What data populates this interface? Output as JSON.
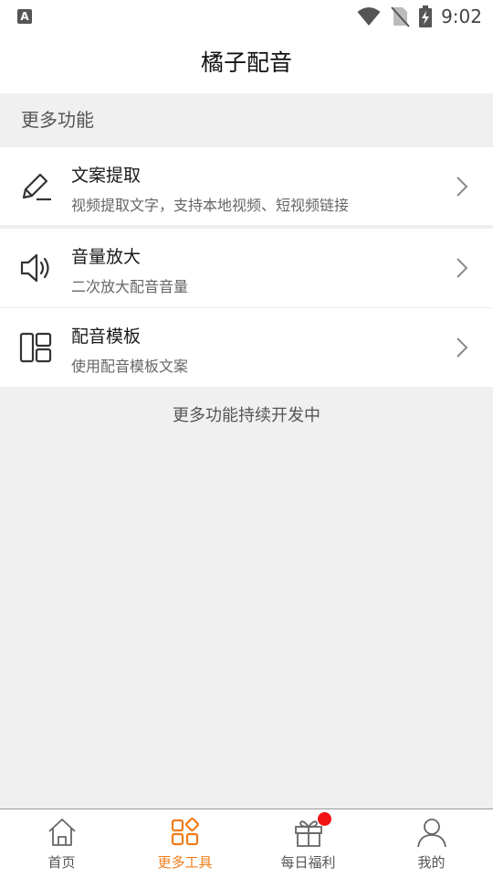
{
  "status_bar": {
    "left_icon_glyph": "A",
    "time": "9:02"
  },
  "header": {
    "title": "橘子配音"
  },
  "section": {
    "label": "更多功能"
  },
  "items": [
    {
      "icon": "pencil-icon",
      "title": "文案提取",
      "subtitle": "视频提取文字，支持本地视频、短视频链接"
    },
    {
      "icon": "speaker-icon",
      "title": "音量放大",
      "subtitle": "二次放大配音音量"
    },
    {
      "icon": "template-icon",
      "title": "配音模板",
      "subtitle": "使用配音模板文案"
    }
  ],
  "footer_note": "更多功能持续开发中",
  "tabs": [
    {
      "label": "首页",
      "icon": "home-icon",
      "active": false
    },
    {
      "label": "更多工具",
      "icon": "tools-grid-icon",
      "active": true
    },
    {
      "label": "每日福利",
      "icon": "gift-icon",
      "active": false
    },
    {
      "label": "我的",
      "icon": "person-icon",
      "active": false
    }
  ],
  "colors": {
    "accent": "#f07c1a",
    "badge": "#f01414",
    "background": "#f0f0f0"
  }
}
